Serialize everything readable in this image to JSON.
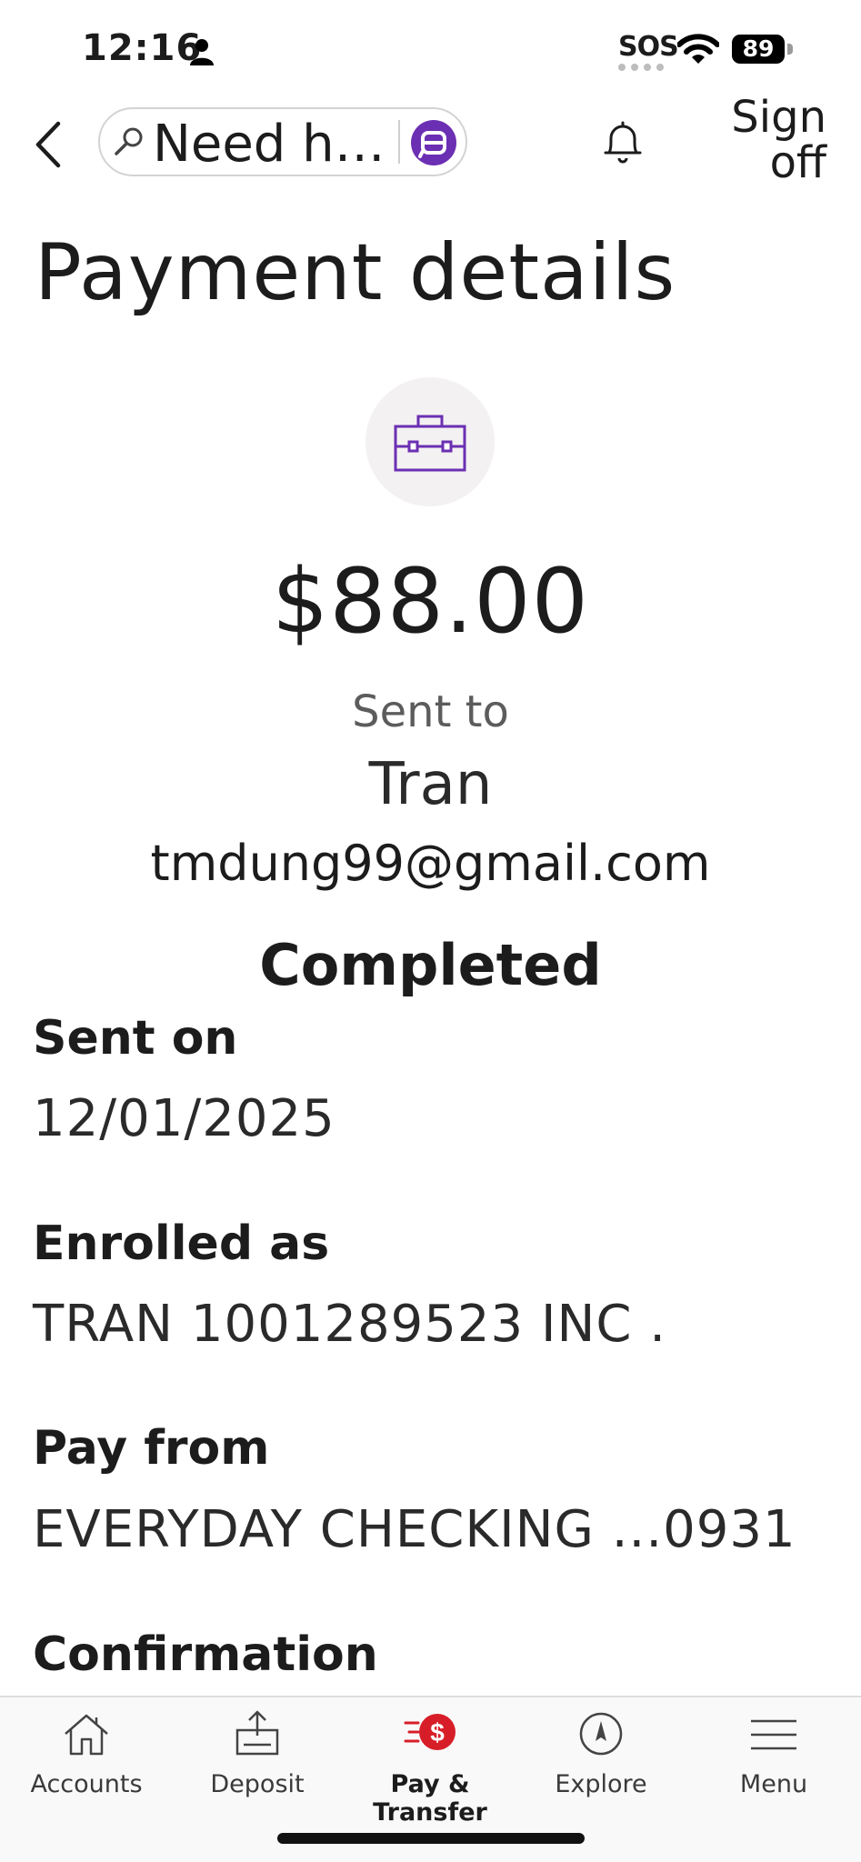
{
  "status_bar": {
    "time": "12:16",
    "sos": "SOS",
    "battery": "89"
  },
  "header": {
    "search_placeholder": "Need h…",
    "sign_off": "Sign off"
  },
  "page_title": "Payment details",
  "payment": {
    "amount": "$88.00",
    "sent_to_label": "Sent to",
    "payee_name": "Tran",
    "payee_email": "tmdung99@gmail.com",
    "status": "Completed"
  },
  "fields": [
    {
      "label": "Sent on",
      "value": "12/01/2025"
    },
    {
      "label": "Enrolled as",
      "value": "TRAN 1001289523 INC ."
    },
    {
      "label": "Pay from",
      "value": "EVERYDAY CHECKING ...0931"
    },
    {
      "label": "Confirmation"
    }
  ],
  "bottom_nav": {
    "items": [
      {
        "label": "Accounts",
        "icon": "home-icon"
      },
      {
        "label": "Deposit",
        "icon": "deposit-icon"
      },
      {
        "label": "Pay & Transfer",
        "icon": "pay-transfer-icon",
        "active": true
      },
      {
        "label": "Explore",
        "icon": "compass-icon"
      },
      {
        "label": "Menu",
        "icon": "hamburger-icon"
      }
    ]
  },
  "colors": {
    "accent_purple": "#6b2fb3",
    "accent_red": "#d71e28",
    "text": "#1c1c1c",
    "muted": "#5c5c5c"
  }
}
